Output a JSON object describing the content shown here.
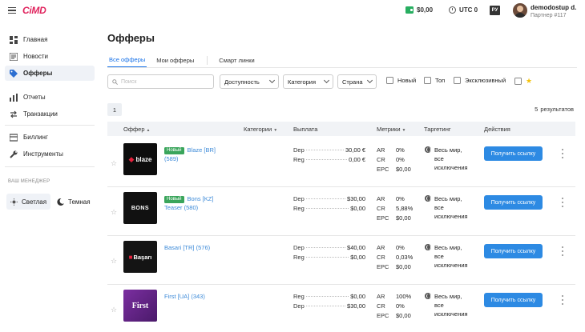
{
  "header": {
    "logo": "CiMD",
    "balance": "$0,00",
    "timezone": "UTC 0",
    "lang": "РУ",
    "user_name": "demodostup d.",
    "user_role": "Партнер #117"
  },
  "sidebar": {
    "items": [
      {
        "label": "Главная",
        "icon": "dashboard-icon"
      },
      {
        "label": "Новости",
        "icon": "news-icon"
      },
      {
        "label": "Офферы",
        "icon": "tag-icon"
      },
      {
        "label": "Отчеты",
        "icon": "chart-icon"
      },
      {
        "label": "Транзакции",
        "icon": "transactions-icon"
      },
      {
        "label": "Биллинг",
        "icon": "billing-icon"
      },
      {
        "label": "Инструменты",
        "icon": "wrench-icon"
      }
    ],
    "manager_label": "ВАШ МЕНЕДЖЕР",
    "theme_light": "Светлая",
    "theme_dark": "Темная"
  },
  "main": {
    "title": "Офферы",
    "tabs": [
      "Все офферы",
      "Мои офферы",
      "Смарт линки"
    ],
    "filters": {
      "search_placeholder": "Поиск",
      "availability": "Доступность",
      "category": "Категория",
      "country": "Страна",
      "new": "Новый",
      "top": "Топ",
      "exclusive": "Эксклюзивный"
    },
    "page": "1",
    "results_count": "5",
    "results_label": "результатов",
    "columns": {
      "offer": "Оффер",
      "categories": "Категории",
      "payout": "Выплата",
      "metrics": "Метрики",
      "targeting": "Таргетинг",
      "actions": "Действия"
    }
  },
  "offers": [
    {
      "badge": "Новый",
      "name": "Blaze [BR]",
      "id": "(589)",
      "thumb_text": "blaze",
      "thumb_bg": "#0d0d0d",
      "payouts": [
        {
          "label": "Dep",
          "value": "30,00 €"
        },
        {
          "label": "Reg",
          "value": "0,00 €"
        }
      ],
      "metrics": {
        "ar": "0%",
        "cr": "0%",
        "epc": "$0,00"
      },
      "geo": "Весь мир, все исключения",
      "button": "Получить ссылку"
    },
    {
      "badge": "Новый",
      "name": "Bons [KZ] Teaser",
      "id": "(580)",
      "thumb_text": "BONS",
      "thumb_bg": "#111111",
      "payouts": [
        {
          "label": "Dep",
          "value": "$30,00"
        },
        {
          "label": "Reg",
          "value": "$0,00"
        }
      ],
      "metrics": {
        "ar": "0%",
        "cr": "5,88%",
        "epc": "$0,00"
      },
      "geo": "Весь мир, все исключения",
      "button": "Получить ссылку"
    },
    {
      "badge": "",
      "name": "Basari [TR]",
      "id": "(576)",
      "thumb_text": "Başarı",
      "thumb_bg": "#141414",
      "payouts": [
        {
          "label": "Dep",
          "value": "$40,00"
        },
        {
          "label": "Reg",
          "value": "$0,00"
        }
      ],
      "metrics": {
        "ar": "0%",
        "cr": "0,03%",
        "epc": "$0,00"
      },
      "geo": "Весь мир, все исключения",
      "button": "Получить ссылку"
    },
    {
      "badge": "",
      "name": "First [UA]",
      "id": "(343)",
      "thumb_text": "First",
      "thumb_bg": "#6a2a8c",
      "payouts": [
        {
          "label": "Reg",
          "value": "$0,00"
        },
        {
          "label": "Dep",
          "value": "$30,00"
        }
      ],
      "metrics": {
        "ar": "100%",
        "cr": "0%",
        "epc": "$0,00"
      },
      "geo": "Весь мир, все исключения",
      "button": "Получить ссылку"
    }
  ],
  "colors": {
    "accent": "#2d8ae3",
    "badge_new": "#3aa55b",
    "link": "#3c8ad8"
  }
}
